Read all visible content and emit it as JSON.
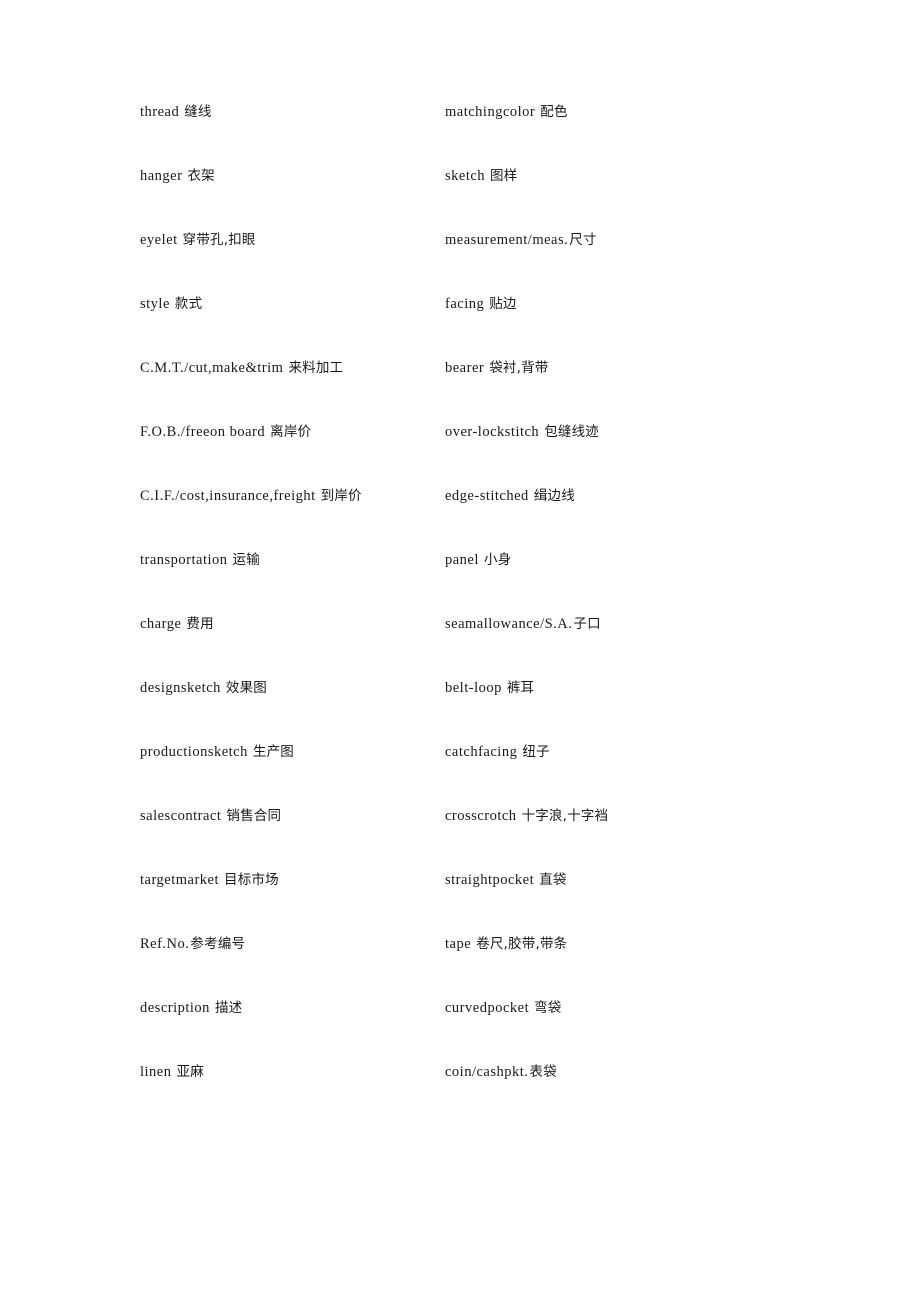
{
  "document": {
    "type": "bilingual-glossary",
    "subject": "garment-industry-terminology",
    "columns": 2,
    "row_count": 16,
    "text_color": "#1a1a1a",
    "background_color": "#ffffff"
  },
  "rows": [
    {
      "left": {
        "term": "thread",
        "gloss": "缝线",
        "tight": false
      },
      "right": {
        "term": "matchingcolor",
        "gloss": "配色",
        "tight": false
      }
    },
    {
      "left": {
        "term": "hanger",
        "gloss": "衣架",
        "tight": false
      },
      "right": {
        "term": "sketch",
        "gloss": "图样",
        "tight": false
      }
    },
    {
      "left": {
        "term": "eyelet",
        "gloss": "穿带孔,扣眼",
        "tight": false
      },
      "right": {
        "term": "measurement/meas.",
        "gloss": "尺寸",
        "tight": true
      }
    },
    {
      "left": {
        "term": "style",
        "gloss": "款式",
        "tight": false
      },
      "right": {
        "term": "facing",
        "gloss": "贴边",
        "tight": false
      }
    },
    {
      "left": {
        "term": "C.M.T./cut,make&trim",
        "gloss": "来料加工",
        "tight": false
      },
      "right": {
        "term": "bearer",
        "gloss": "袋衬,背带",
        "tight": false
      }
    },
    {
      "left": {
        "term": "F.O.B./freeon board",
        "gloss": "离岸价",
        "tight": false
      },
      "right": {
        "term": "over-lockstitch",
        "gloss": "包缝线迹",
        "tight": false
      }
    },
    {
      "left": {
        "term": "C.I.F./cost,insurance,freight",
        "gloss": "到岸价",
        "tight": false
      },
      "right": {
        "term": "edge-stitched",
        "gloss": "缉边线",
        "tight": false
      }
    },
    {
      "left": {
        "term": "transportation",
        "gloss": "运输",
        "tight": false
      },
      "right": {
        "term": "panel",
        "gloss": "小身",
        "tight": false
      }
    },
    {
      "left": {
        "term": "charge",
        "gloss": "费用",
        "tight": false
      },
      "right": {
        "term": "seamallowance/S.A.",
        "gloss": "子口",
        "tight": true
      }
    },
    {
      "left": {
        "term": "designsketch",
        "gloss": "效果图",
        "tight": false
      },
      "right": {
        "term": "belt-loop",
        "gloss": "裤耳",
        "tight": false
      }
    },
    {
      "left": {
        "term": "productionsketch",
        "gloss": "生产图",
        "tight": false
      },
      "right": {
        "term": "catchfacing",
        "gloss": "纽子",
        "tight": false
      }
    },
    {
      "left": {
        "term": "salescontract",
        "gloss": "销售合同",
        "tight": false
      },
      "right": {
        "term": "crosscrotch",
        "gloss": "十字浪,十字裆",
        "tight": false
      }
    },
    {
      "left": {
        "term": "targetmarket",
        "gloss": "目标市场",
        "tight": false
      },
      "right": {
        "term": "straightpocket",
        "gloss": "直袋",
        "tight": false
      }
    },
    {
      "left": {
        "term": "Ref.No.",
        "gloss": "参考编号",
        "tight": true
      },
      "right": {
        "term": "tape",
        "gloss": "卷尺,胶带,带条",
        "tight": false
      }
    },
    {
      "left": {
        "term": "description",
        "gloss": "描述",
        "tight": false
      },
      "right": {
        "term": "curvedpocket",
        "gloss": "弯袋",
        "tight": false
      }
    },
    {
      "left": {
        "term": "linen",
        "gloss": "亚麻",
        "tight": false
      },
      "right": {
        "term": "coin/cashpkt.",
        "gloss": "表袋",
        "tight": true
      }
    }
  ]
}
